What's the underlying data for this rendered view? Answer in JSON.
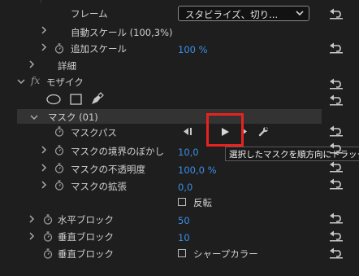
{
  "effect_controls": {
    "frame_label": "フレーム",
    "frame_dropdown_value": "スタビライズ、切り...",
    "auto_scale_label": "自動スケール (100,3%)",
    "additional_scale_label": "追加スケール",
    "additional_scale_value": "100 %",
    "details_label": "詳細",
    "fx_badge": "fx",
    "mosaic_label": "モザイク",
    "mask_group_label": "マスク (01)",
    "mask_path_label": "マスクパス",
    "mask_feather_label": "マスクの境界のぼかし",
    "mask_feather_value": "10,0",
    "mask_opacity_label": "マスクの不透明度",
    "mask_opacity_value": "100,0 %",
    "mask_expansion_label": "マスクの拡張",
    "mask_expansion_value": "0,0",
    "inverted_label": "反転",
    "horizontal_blocks_label": "水平ブロック",
    "horizontal_blocks_value": "50",
    "vertical_blocks_label": "垂直ブロック",
    "vertical_blocks_value": "10",
    "vertical_blocks2_label": "垂直ブロック",
    "sharp_colors_label": "シャープカラー",
    "tooltip": "選択したマスクを順方向にトラック"
  },
  "colors": {
    "background": "#1e1e1e",
    "value_blue": "#3b8de6",
    "highlight_red": "#e8231f",
    "tooltip_bg": "#1a1a1a"
  },
  "icons": {
    "reset": "reset-arrow-icon",
    "stopwatch": "stopwatch-icon",
    "ellipse_mask": "ellipse-mask-icon",
    "rect_mask": "rectangle-mask-icon",
    "pen_mask": "pen-mask-icon",
    "track_backward_one": "track-backward-one-frame-icon",
    "track_forward": "track-forward-icon",
    "track_forward_one": "track-forward-one-frame-icon",
    "wrench": "wrench-icon"
  }
}
